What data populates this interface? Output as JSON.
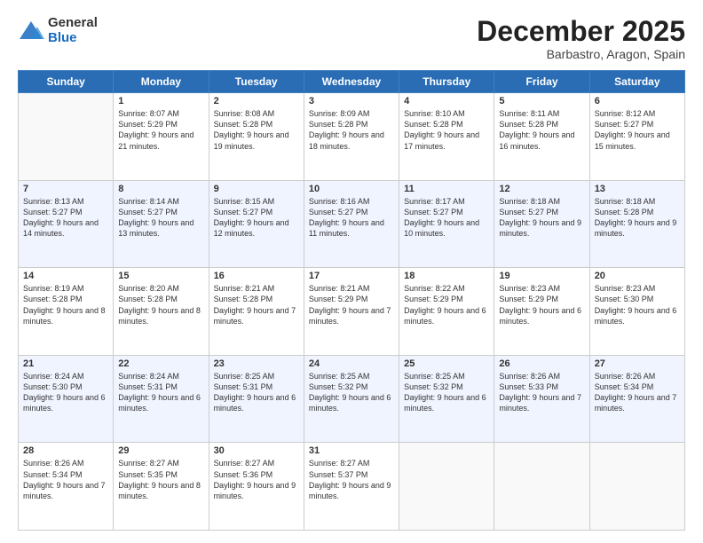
{
  "logo": {
    "general": "General",
    "blue": "Blue"
  },
  "header": {
    "month": "December 2025",
    "location": "Barbastro, Aragon, Spain"
  },
  "days": [
    "Sunday",
    "Monday",
    "Tuesday",
    "Wednesday",
    "Thursday",
    "Friday",
    "Saturday"
  ],
  "weeks": [
    [
      {
        "day": "",
        "sunrise": "",
        "sunset": "",
        "daylight": ""
      },
      {
        "day": "1",
        "sunrise": "Sunrise: 8:07 AM",
        "sunset": "Sunset: 5:29 PM",
        "daylight": "Daylight: 9 hours and 21 minutes."
      },
      {
        "day": "2",
        "sunrise": "Sunrise: 8:08 AM",
        "sunset": "Sunset: 5:28 PM",
        "daylight": "Daylight: 9 hours and 19 minutes."
      },
      {
        "day": "3",
        "sunrise": "Sunrise: 8:09 AM",
        "sunset": "Sunset: 5:28 PM",
        "daylight": "Daylight: 9 hours and 18 minutes."
      },
      {
        "day": "4",
        "sunrise": "Sunrise: 8:10 AM",
        "sunset": "Sunset: 5:28 PM",
        "daylight": "Daylight: 9 hours and 17 minutes."
      },
      {
        "day": "5",
        "sunrise": "Sunrise: 8:11 AM",
        "sunset": "Sunset: 5:28 PM",
        "daylight": "Daylight: 9 hours and 16 minutes."
      },
      {
        "day": "6",
        "sunrise": "Sunrise: 8:12 AM",
        "sunset": "Sunset: 5:27 PM",
        "daylight": "Daylight: 9 hours and 15 minutes."
      }
    ],
    [
      {
        "day": "7",
        "sunrise": "Sunrise: 8:13 AM",
        "sunset": "Sunset: 5:27 PM",
        "daylight": "Daylight: 9 hours and 14 minutes."
      },
      {
        "day": "8",
        "sunrise": "Sunrise: 8:14 AM",
        "sunset": "Sunset: 5:27 PM",
        "daylight": "Daylight: 9 hours and 13 minutes."
      },
      {
        "day": "9",
        "sunrise": "Sunrise: 8:15 AM",
        "sunset": "Sunset: 5:27 PM",
        "daylight": "Daylight: 9 hours and 12 minutes."
      },
      {
        "day": "10",
        "sunrise": "Sunrise: 8:16 AM",
        "sunset": "Sunset: 5:27 PM",
        "daylight": "Daylight: 9 hours and 11 minutes."
      },
      {
        "day": "11",
        "sunrise": "Sunrise: 8:17 AM",
        "sunset": "Sunset: 5:27 PM",
        "daylight": "Daylight: 9 hours and 10 minutes."
      },
      {
        "day": "12",
        "sunrise": "Sunrise: 8:18 AM",
        "sunset": "Sunset: 5:27 PM",
        "daylight": "Daylight: 9 hours and 9 minutes."
      },
      {
        "day": "13",
        "sunrise": "Sunrise: 8:18 AM",
        "sunset": "Sunset: 5:28 PM",
        "daylight": "Daylight: 9 hours and 9 minutes."
      }
    ],
    [
      {
        "day": "14",
        "sunrise": "Sunrise: 8:19 AM",
        "sunset": "Sunset: 5:28 PM",
        "daylight": "Daylight: 9 hours and 8 minutes."
      },
      {
        "day": "15",
        "sunrise": "Sunrise: 8:20 AM",
        "sunset": "Sunset: 5:28 PM",
        "daylight": "Daylight: 9 hours and 8 minutes."
      },
      {
        "day": "16",
        "sunrise": "Sunrise: 8:21 AM",
        "sunset": "Sunset: 5:28 PM",
        "daylight": "Daylight: 9 hours and 7 minutes."
      },
      {
        "day": "17",
        "sunrise": "Sunrise: 8:21 AM",
        "sunset": "Sunset: 5:29 PM",
        "daylight": "Daylight: 9 hours and 7 minutes."
      },
      {
        "day": "18",
        "sunrise": "Sunrise: 8:22 AM",
        "sunset": "Sunset: 5:29 PM",
        "daylight": "Daylight: 9 hours and 6 minutes."
      },
      {
        "day": "19",
        "sunrise": "Sunrise: 8:23 AM",
        "sunset": "Sunset: 5:29 PM",
        "daylight": "Daylight: 9 hours and 6 minutes."
      },
      {
        "day": "20",
        "sunrise": "Sunrise: 8:23 AM",
        "sunset": "Sunset: 5:30 PM",
        "daylight": "Daylight: 9 hours and 6 minutes."
      }
    ],
    [
      {
        "day": "21",
        "sunrise": "Sunrise: 8:24 AM",
        "sunset": "Sunset: 5:30 PM",
        "daylight": "Daylight: 9 hours and 6 minutes."
      },
      {
        "day": "22",
        "sunrise": "Sunrise: 8:24 AM",
        "sunset": "Sunset: 5:31 PM",
        "daylight": "Daylight: 9 hours and 6 minutes."
      },
      {
        "day": "23",
        "sunrise": "Sunrise: 8:25 AM",
        "sunset": "Sunset: 5:31 PM",
        "daylight": "Daylight: 9 hours and 6 minutes."
      },
      {
        "day": "24",
        "sunrise": "Sunrise: 8:25 AM",
        "sunset": "Sunset: 5:32 PM",
        "daylight": "Daylight: 9 hours and 6 minutes."
      },
      {
        "day": "25",
        "sunrise": "Sunrise: 8:25 AM",
        "sunset": "Sunset: 5:32 PM",
        "daylight": "Daylight: 9 hours and 6 minutes."
      },
      {
        "day": "26",
        "sunrise": "Sunrise: 8:26 AM",
        "sunset": "Sunset: 5:33 PM",
        "daylight": "Daylight: 9 hours and 7 minutes."
      },
      {
        "day": "27",
        "sunrise": "Sunrise: 8:26 AM",
        "sunset": "Sunset: 5:34 PM",
        "daylight": "Daylight: 9 hours and 7 minutes."
      }
    ],
    [
      {
        "day": "28",
        "sunrise": "Sunrise: 8:26 AM",
        "sunset": "Sunset: 5:34 PM",
        "daylight": "Daylight: 9 hours and 7 minutes."
      },
      {
        "day": "29",
        "sunrise": "Sunrise: 8:27 AM",
        "sunset": "Sunset: 5:35 PM",
        "daylight": "Daylight: 9 hours and 8 minutes."
      },
      {
        "day": "30",
        "sunrise": "Sunrise: 8:27 AM",
        "sunset": "Sunset: 5:36 PM",
        "daylight": "Daylight: 9 hours and 9 minutes."
      },
      {
        "day": "31",
        "sunrise": "Sunrise: 8:27 AM",
        "sunset": "Sunset: 5:37 PM",
        "daylight": "Daylight: 9 hours and 9 minutes."
      },
      {
        "day": "",
        "sunrise": "",
        "sunset": "",
        "daylight": ""
      },
      {
        "day": "",
        "sunrise": "",
        "sunset": "",
        "daylight": ""
      },
      {
        "day": "",
        "sunrise": "",
        "sunset": "",
        "daylight": ""
      }
    ]
  ]
}
